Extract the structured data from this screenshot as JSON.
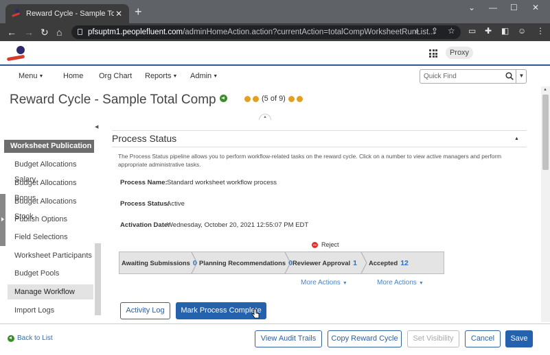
{
  "browser": {
    "tab_title": "Reward Cycle - Sample Total Com",
    "url_host": "pfsuptm1.peoplefluent.com",
    "url_path": "/adminHomeAction.action?currentAction=totalCompWorksheetRunList..."
  },
  "header": {
    "proxy_label": "Proxy"
  },
  "menu": {
    "items": [
      "Menu",
      "Home",
      "Org Chart",
      "Reports",
      "Admin"
    ],
    "quick_find_placeholder": "Quick Find"
  },
  "page": {
    "title": "Reward Cycle - Sample Total Comp",
    "pager_text": "(5 of 9)"
  },
  "sidebar": {
    "section_title": "Worksheet Publication",
    "items": [
      "Budget Allocations Salary",
      "Budget Allocations Bonus",
      "Budget Allocations Stock",
      "Publish Options",
      "Field Selections",
      "Worksheet Participants",
      "Budget Pools",
      "Manage Workflow",
      "Import Logs"
    ],
    "active_item": "Manage Workflow"
  },
  "process_status": {
    "heading": "Process Status",
    "description": "The Process Status pipeline allows you to perform workflow-related tasks on the reward cycle. Click on a number to view active managers and perform appropriate administrative tasks.",
    "fields": [
      {
        "label": "Process Name:",
        "value": "Standard worksheet workflow process"
      },
      {
        "label": "Process Status:",
        "value": "Active"
      },
      {
        "label": "Activation Date:",
        "value": "Wednesday, October 20, 2021 12:55:07 PM EDT"
      }
    ],
    "reject_label": "Reject",
    "stages": [
      {
        "label": "Awaiting Submissions",
        "count": "0"
      },
      {
        "label": "Planning Recommendations",
        "count": "0"
      },
      {
        "label": "Reviewer Approval",
        "count": "1"
      },
      {
        "label": "Accepted",
        "count": "12"
      }
    ],
    "more_actions_label": "More Actions",
    "activity_log_label": "Activity Log",
    "mark_complete_label": "Mark Process Complete"
  },
  "footer": {
    "back_to_list": "Back to List",
    "view_audit_trails": "View Audit Trails",
    "copy_reward_cycle": "Copy Reward Cycle",
    "set_visibility": "Set Visibility",
    "cancel": "Cancel",
    "save": "Save"
  },
  "colors": {
    "primary": "#2562ad",
    "link": "#2f6fb8",
    "sidebar_section": "#6d6d6d",
    "header_rule": "#2b5797"
  }
}
